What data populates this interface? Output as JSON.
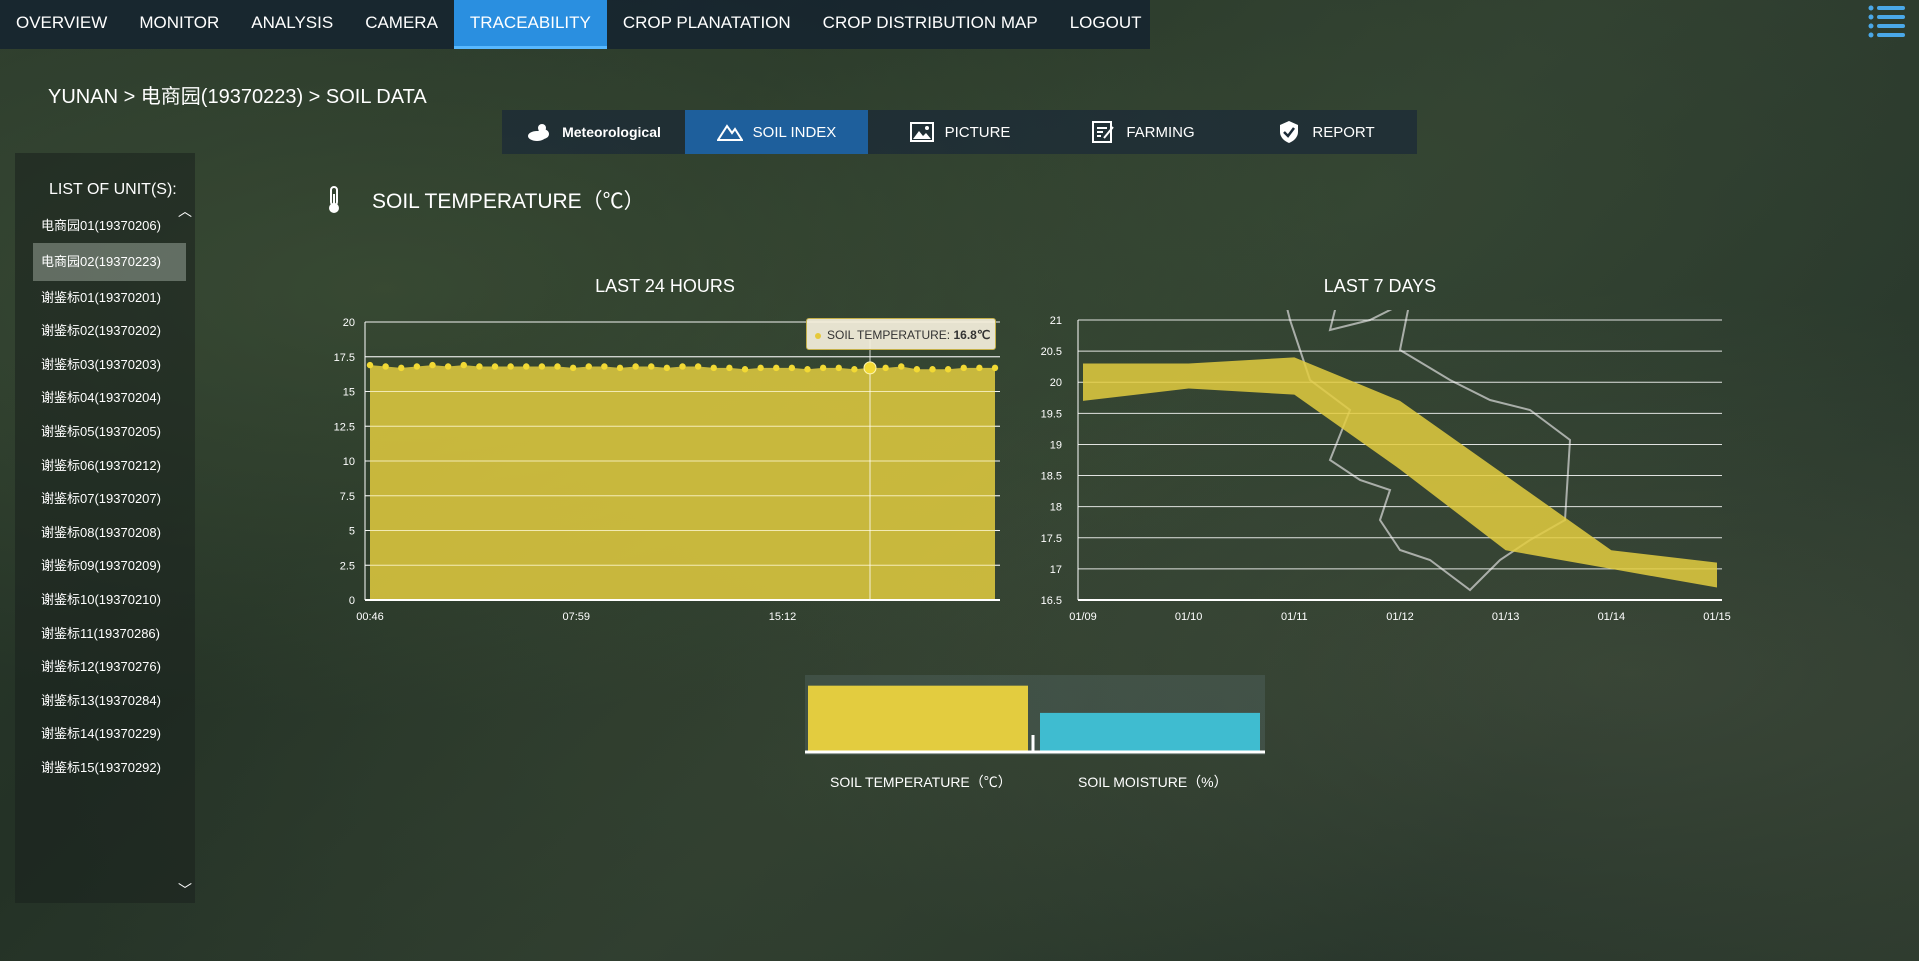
{
  "nav": {
    "items": [
      "OVERVIEW",
      "MONITOR",
      "ANALYSIS",
      "CAMERA",
      "TRACEABILITY",
      "CROP PLANATATION",
      "CROP DISTRIBUTION MAP",
      "LOGOUT"
    ],
    "active": "TRACEABILITY",
    "menu_icon": "menu-list-icon"
  },
  "breadcrumb": "YUNAN > 电商园(19370223) > SOIL DATA",
  "tabs": [
    {
      "label": "Meteorological",
      "icon": "weather-icon"
    },
    {
      "label": "SOIL INDEX",
      "icon": "mountain-icon"
    },
    {
      "label": "PICTURE",
      "icon": "picture-icon"
    },
    {
      "label": "FARMING",
      "icon": "farming-icon"
    },
    {
      "label": "REPORT",
      "icon": "shield-check-icon"
    }
  ],
  "active_tab": "SOIL INDEX",
  "sidebar": {
    "title": "LIST OF UNIT(S):",
    "selected": "电商园02(19370223)",
    "units": [
      "电商园01(19370206)",
      "电商园02(19370223)",
      "谢鉴标01(19370201)",
      "谢鉴标02(19370202)",
      "谢鉴标03(19370203)",
      "谢鉴标04(19370204)",
      "谢鉴标05(19370205)",
      "谢鉴标06(19370212)",
      "谢鉴标07(19370207)",
      "谢鉴标08(19370208)",
      "谢鉴标09(19370209)",
      "谢鉴标10(19370210)",
      "谢鉴标11(19370286)",
      "谢鉴标12(19370276)",
      "谢鉴标13(19370284)",
      "谢鉴标14(19370229)",
      "谢鉴标15(19370292)"
    ]
  },
  "section_title": "SOIL TEMPERATURE（℃）",
  "section_icon": "thermometer-icon",
  "tooltip": {
    "label": "SOIL TEMPERATURE:",
    "value": "16.8℃"
  },
  "colors": {
    "yellow": "#e3cc3f",
    "cyan": "#3fbcd0",
    "nav_active": "#2a8fe0",
    "tab_active": "#1e5f9c"
  },
  "chart_data": [
    {
      "type": "area",
      "title": "LAST 24 HOURS",
      "x_ticks": [
        "00:46",
        "07:59",
        "15:12"
      ],
      "y_ticks": [
        "0",
        "2.5",
        "5",
        "7.5",
        "10",
        "12.5",
        "15",
        "17.5",
        "20"
      ],
      "ylim": [
        0,
        20
      ],
      "values": [
        16.9,
        16.8,
        16.7,
        16.8,
        16.9,
        16.8,
        16.9,
        16.8,
        16.8,
        16.8,
        16.8,
        16.8,
        16.8,
        16.7,
        16.8,
        16.8,
        16.7,
        16.8,
        16.8,
        16.7,
        16.8,
        16.8,
        16.7,
        16.7,
        16.6,
        16.7,
        16.7,
        16.7,
        16.6,
        16.7,
        16.7,
        16.6,
        16.7,
        16.7,
        16.8,
        16.6,
        16.6,
        16.6,
        16.7,
        16.7,
        16.7
      ],
      "highlight_index": 32
    },
    {
      "type": "area",
      "title": "LAST 7 DAYS",
      "categories": [
        "01/09",
        "01/10",
        "01/11",
        "01/12",
        "01/13",
        "01/14",
        "01/15"
      ],
      "y_ticks": [
        "16.5",
        "17",
        "17.5",
        "18",
        "18.5",
        "19",
        "19.5",
        "20",
        "20.5",
        "21"
      ],
      "ylim": [
        16.5,
        21
      ],
      "upper": [
        20.3,
        20.3,
        20.4,
        19.7,
        18.5,
        17.3,
        17.1
      ],
      "lower": [
        19.7,
        19.9,
        19.8,
        18.6,
        17.3,
        17.0,
        16.7
      ]
    },
    {
      "type": "bar",
      "categories": [
        "SOIL TEMPERATURE（℃）",
        "SOIL MOISTURE（%）"
      ],
      "values": [
        16.8,
        9.8
      ],
      "colors": [
        "#e3cc3f",
        "#3fbcd0"
      ]
    }
  ]
}
